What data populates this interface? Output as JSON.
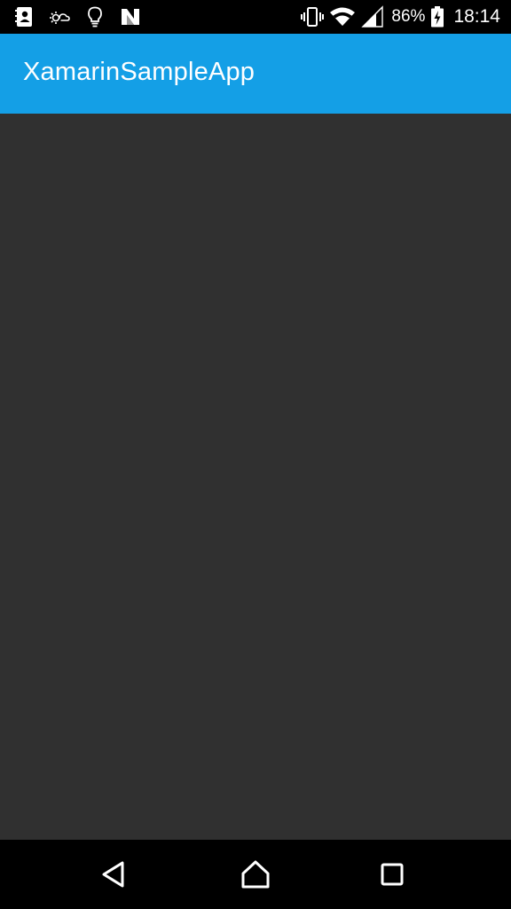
{
  "status_bar": {
    "left_icons": [
      "contacts-notification-icon",
      "weather-icon",
      "lightbulb-icon",
      "n-app-icon"
    ],
    "right_icons": [
      "vibrate-icon",
      "wifi-icon",
      "cell-signal-icon"
    ],
    "battery_percent": "86%",
    "battery_state": "charging",
    "time": "18:14"
  },
  "app_bar": {
    "title": "XamarinSampleApp",
    "color": "#149fe6"
  },
  "content": {
    "background": "#303030"
  },
  "nav_bar": {
    "buttons": [
      "back-icon",
      "home-icon",
      "recents-icon"
    ]
  }
}
